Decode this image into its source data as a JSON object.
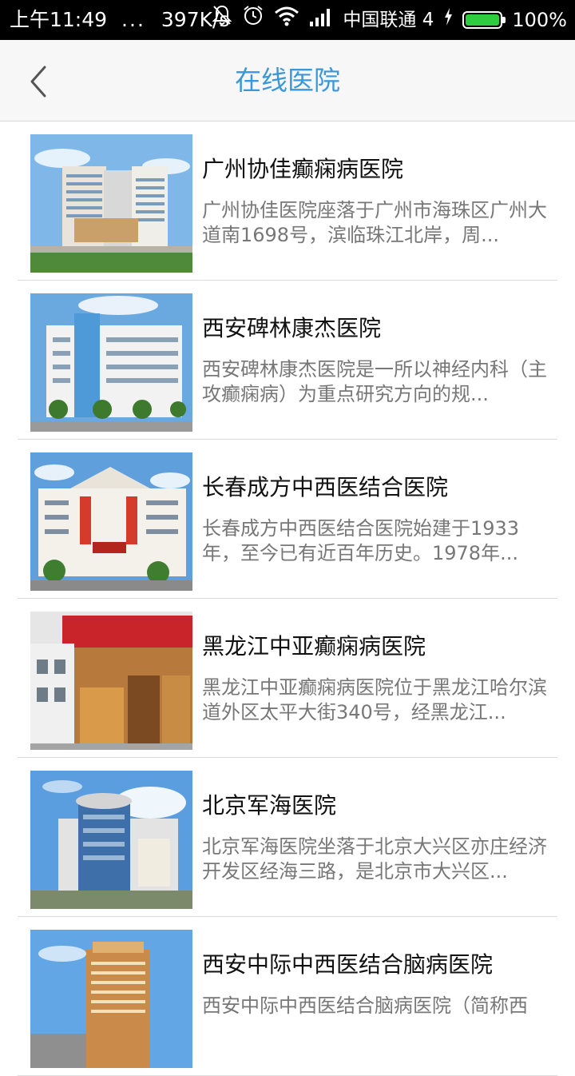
{
  "status_bar": {
    "time": "上午11:49",
    "dots": "...",
    "speed": "397K/s",
    "carrier": "中国联通 4",
    "battery": "100%"
  },
  "header": {
    "title": "在线医院",
    "back_icon": "chevron-left-icon"
  },
  "colors": {
    "accent": "#3a98d8",
    "title_bar": "#f7f7f7",
    "divider": "#dcdcdc"
  },
  "hospitals": [
    {
      "name": "广州协佳癫痫病医院",
      "desc": "广州协佳医院座落于广州市海珠区广州大道南1698号，滨临珠江北岸，周..."
    },
    {
      "name": "西安碑林康杰医院",
      "desc": "西安碑林康杰医院是一所以神经内科（主攻癫痫病）为重点研究方向的规..."
    },
    {
      "name": "长春成方中西医结合医院",
      "desc": "长春成方中西医结合医院始建于1933年，至今已有近百年历史。1978年..."
    },
    {
      "name": "黑龙江中亚癫痫病医院",
      "desc": "黑龙江中亚癫痫病医院位于黑龙江哈尔滨道外区太平大街340号，经黑龙江..."
    },
    {
      "name": "北京军海医院",
      "desc": "北京军海医院坐落于北京大兴区亦庄经济开发区经海三路，是北京市大兴区..."
    },
    {
      "name": "西安中际中西医结合脑病医院",
      "desc": "西安中际中西医结合脑病医院（简称西"
    }
  ]
}
